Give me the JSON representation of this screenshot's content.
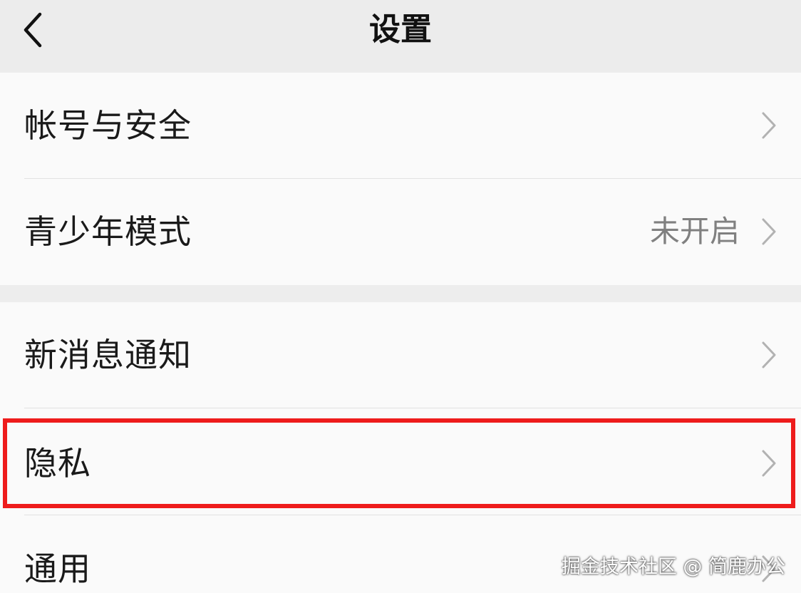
{
  "navbar": {
    "title": "设置",
    "back_icon": "chevron-left-icon"
  },
  "groups": [
    {
      "items": [
        {
          "label": "帐号与安全",
          "value": "",
          "icon": "chevron-right-icon"
        },
        {
          "label": "青少年模式",
          "value": "未开启",
          "icon": "chevron-right-icon"
        }
      ]
    },
    {
      "items": [
        {
          "label": "新消息通知",
          "value": "",
          "icon": "chevron-right-icon"
        },
        {
          "label": "隐私",
          "value": "",
          "icon": "chevron-right-icon",
          "highlighted": true
        },
        {
          "label": "通用",
          "value": "",
          "icon": "chevron-right-icon"
        }
      ]
    }
  ],
  "highlight": {
    "color": "#ee1c1c",
    "target": "隐私"
  },
  "watermark": "掘金技术社区 @ 简鹿办公",
  "colors": {
    "background": "#ededed",
    "cell_background": "#fafafa",
    "text": "#1a1a1a",
    "secondary_text": "#808080",
    "chevron": "#b2b2b2"
  }
}
